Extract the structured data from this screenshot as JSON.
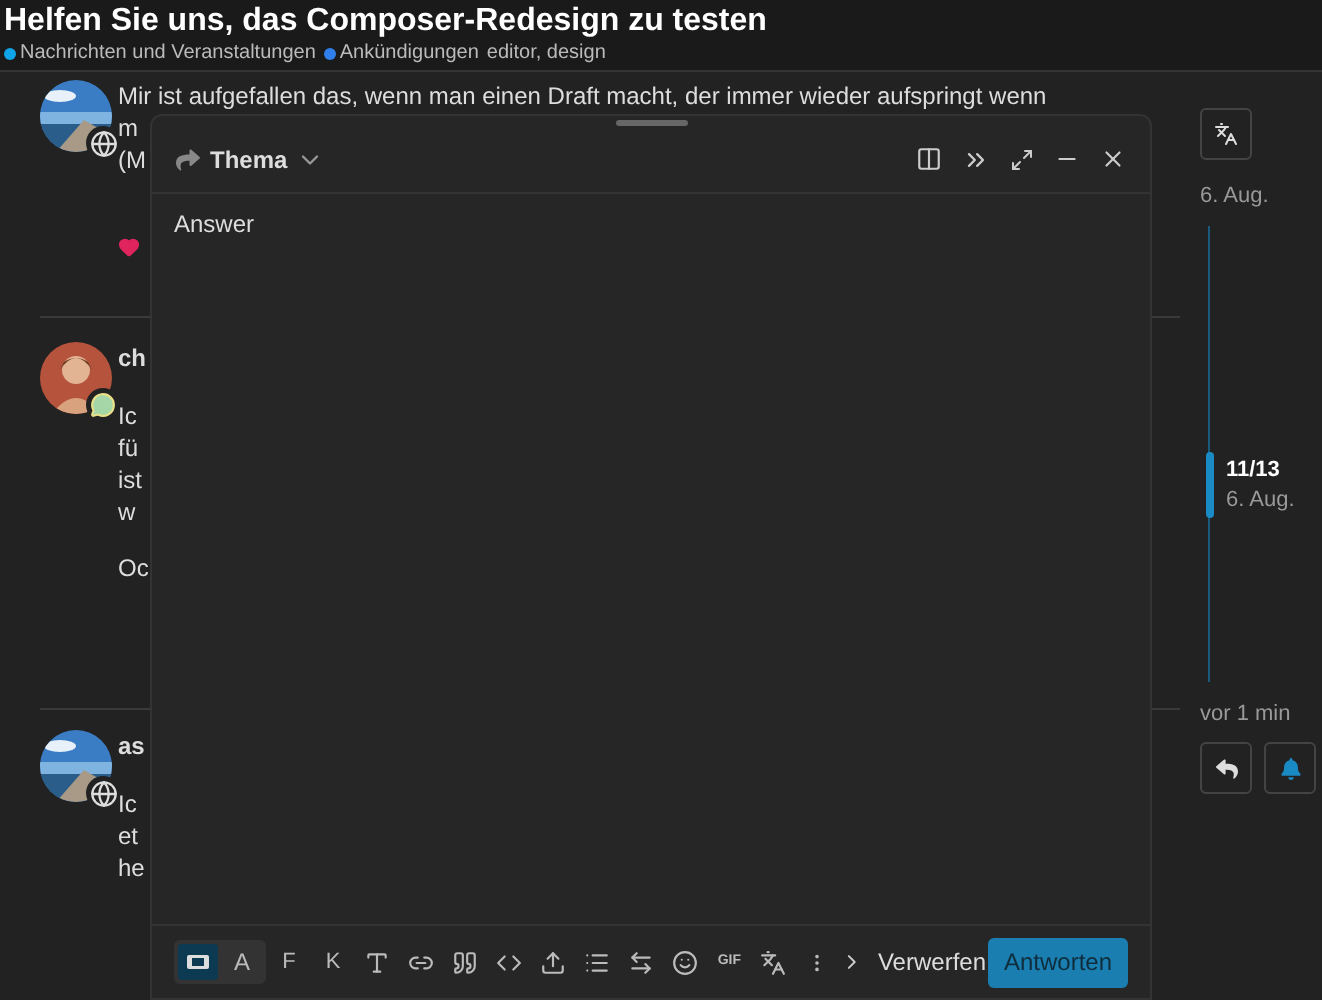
{
  "header": {
    "title": "Helfen Sie uns, das Composer-Redesign zu testen",
    "categories": [
      {
        "label": "Nachrichten und Veranstaltungen",
        "color": "#0ea5e9"
      },
      {
        "label": "Ankündigungen",
        "color": "#2f80ed"
      }
    ],
    "tags": "editor, design"
  },
  "posts": [
    {
      "kind": "globe",
      "paragraphs": [
        [
          "Mir ist aufgefallen das, wenn man einen Draft macht, der immer wieder aufspringt wenn",
          "m",
          "(M"
        ]
      ],
      "liked": true
    },
    {
      "kind": "chat",
      "author": "ch",
      "paragraphs": [
        [
          "Ic",
          "fü",
          "ist",
          "w"
        ],
        [
          "Oc"
        ]
      ],
      "liked": false
    },
    {
      "kind": "globe",
      "author": "as",
      "paragraphs": [
        [
          "Ic",
          "et",
          "he"
        ]
      ],
      "liked": false
    }
  ],
  "composer": {
    "action": "Thema",
    "value": "Answer",
    "modes": [
      {
        "kind": "icon",
        "selected": true
      },
      {
        "kind": "text",
        "label": "A",
        "selected": false
      }
    ],
    "tools": [
      {
        "kind": "text",
        "label": "F"
      },
      {
        "kind": "text",
        "label": "K"
      },
      {
        "kind": "icon"
      },
      {
        "kind": "icon"
      },
      {
        "kind": "icon"
      },
      {
        "kind": "icon"
      },
      {
        "kind": "icon"
      },
      {
        "kind": "icon"
      },
      {
        "kind": "icon"
      },
      {
        "kind": "icon"
      },
      {
        "kind": "small",
        "label": "GIF"
      },
      {
        "kind": "icon"
      },
      {
        "kind": "icon"
      }
    ],
    "discard": "Verwerfen",
    "submit": "Antworten"
  },
  "timeline": {
    "top_date": "6. Aug.",
    "position": "11/13",
    "position_date": "6. Aug.",
    "level": 0.57,
    "bottom": "vor 1 min"
  }
}
